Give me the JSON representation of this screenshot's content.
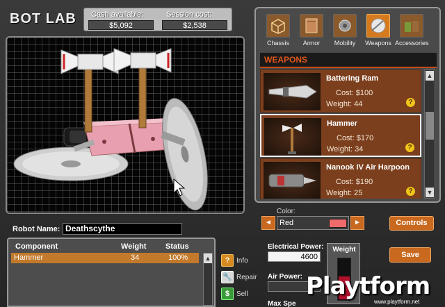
{
  "header": {
    "title": "BOT LAB",
    "cash_label": "Cash available:",
    "cash_value": "$5,092",
    "session_label": "Session cost:",
    "session_value": "$2,538"
  },
  "categories": [
    {
      "label": "Chassis",
      "icon": "chassis-icon"
    },
    {
      "label": "Armor",
      "icon": "armor-icon"
    },
    {
      "label": "Mobility",
      "icon": "mobility-icon"
    },
    {
      "label": "Weapons",
      "icon": "weapons-icon",
      "active": true
    },
    {
      "label": "Accessories",
      "icon": "accessories-icon"
    }
  ],
  "weapons_title": "WEAPONS",
  "weapons": [
    {
      "name": "Battering Ram",
      "cost": "Cost:  $100",
      "weight": "Weight:  44"
    },
    {
      "name": "Hammer",
      "cost": "Cost:  $170",
      "weight": "Weight:  34"
    },
    {
      "name": "Nanook IV Air Harpoon",
      "cost": "Cost:  $190",
      "weight": "Weight:  25"
    }
  ],
  "help_glyph": "?",
  "color": {
    "label": "Color:",
    "value": "Red",
    "swatch": "#ef6b6b",
    "prev_glyph": "◄",
    "next_glyph": "►"
  },
  "controls_label": "Controls",
  "robot": {
    "name_label": "Robot Name:",
    "name_value": "Deathscythe"
  },
  "components": {
    "headers": [
      "Component",
      "Weight",
      "Status"
    ],
    "rows": [
      {
        "component": "Hammer",
        "weight": "34",
        "status": "100%"
      }
    ]
  },
  "scroll_up_glyph": "▲",
  "scroll_down_glyph": "▼",
  "actions": [
    {
      "label": "Info",
      "glyph": "?"
    },
    {
      "label": "Repair",
      "glyph": "🔧"
    },
    {
      "label": "Sell",
      "glyph": "$"
    }
  ],
  "stats": {
    "electrical_label": "Electrical Power:",
    "electrical_value": "4600",
    "air_label": "Air Power:",
    "max_speed_label": "Max Spe",
    "weight_label": "Weight",
    "weight_fill_fraction": 0.55
  },
  "save_label": "Save",
  "watermark": {
    "logo": "Playtform",
    "url": "www.playtform.net"
  },
  "colors": {
    "accent": "#c9691f",
    "card_bg": "#7c3f1d",
    "header_red": "#e0571c",
    "robot_body": "#e8a0b0"
  }
}
